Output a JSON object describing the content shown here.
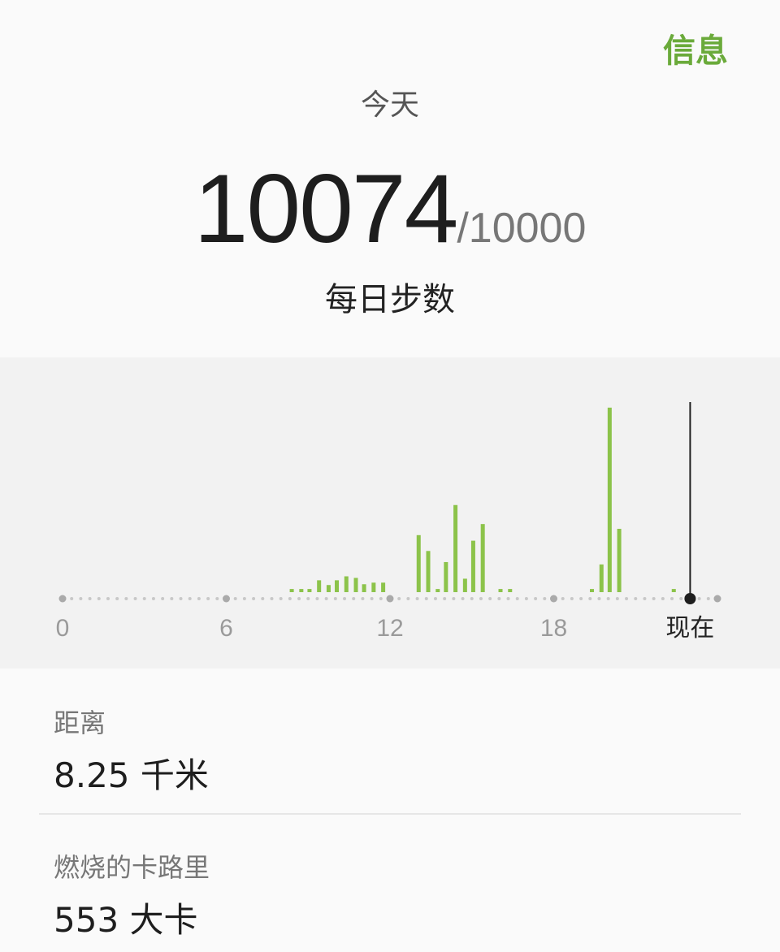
{
  "header": {
    "info_label": "信息",
    "period": "今天",
    "steps": "10074",
    "goal": "/10000",
    "title": "每日步数"
  },
  "colors": {
    "accent": "#6aaa3a",
    "bar": "#8cc34a",
    "axis_dot": "#c8c8c8",
    "axis_major_dot": "#aaaaaa",
    "now_marker": "#1e1e1e"
  },
  "chart_data": {
    "type": "bar",
    "xlim": [
      0,
      24
    ],
    "x_ticks": [
      {
        "value": 0,
        "label": "0"
      },
      {
        "value": 6,
        "label": "6"
      },
      {
        "value": 12,
        "label": "12"
      },
      {
        "value": 18,
        "label": "18"
      }
    ],
    "now": {
      "value": 23.0,
      "label": "现在"
    },
    "bars": [
      {
        "x": 8.4,
        "value": 0.4
      },
      {
        "x": 8.75,
        "value": 0.4
      },
      {
        "x": 9.05,
        "value": 0.4
      },
      {
        "x": 9.4,
        "value": 1.5
      },
      {
        "x": 9.75,
        "value": 0.9
      },
      {
        "x": 10.05,
        "value": 1.5
      },
      {
        "x": 10.4,
        "value": 2.0
      },
      {
        "x": 10.75,
        "value": 1.8
      },
      {
        "x": 11.05,
        "value": 1.0
      },
      {
        "x": 11.4,
        "value": 1.2
      },
      {
        "x": 11.75,
        "value": 1.2
      },
      {
        "x": 13.05,
        "value": 7.2
      },
      {
        "x": 13.4,
        "value": 5.2
      },
      {
        "x": 13.75,
        "value": 0.4
      },
      {
        "x": 14.05,
        "value": 3.8
      },
      {
        "x": 14.4,
        "value": 11.0
      },
      {
        "x": 14.75,
        "value": 1.7
      },
      {
        "x": 15.05,
        "value": 6.5
      },
      {
        "x": 15.4,
        "value": 8.6
      },
      {
        "x": 16.05,
        "value": 0.4
      },
      {
        "x": 16.4,
        "value": 0.4
      },
      {
        "x": 19.4,
        "value": 0.4
      },
      {
        "x": 19.75,
        "value": 3.5
      },
      {
        "x": 20.05,
        "value": 23.3
      },
      {
        "x": 20.4,
        "value": 8.0
      },
      {
        "x": 22.4,
        "value": 0.4
      }
    ],
    "ylim": [
      0,
      24
    ],
    "grid": false,
    "legend": "none"
  },
  "stats": [
    {
      "label": "距离",
      "value": "8.25 千米"
    },
    {
      "label": "燃烧的卡路里",
      "value": "553 大卡"
    }
  ]
}
